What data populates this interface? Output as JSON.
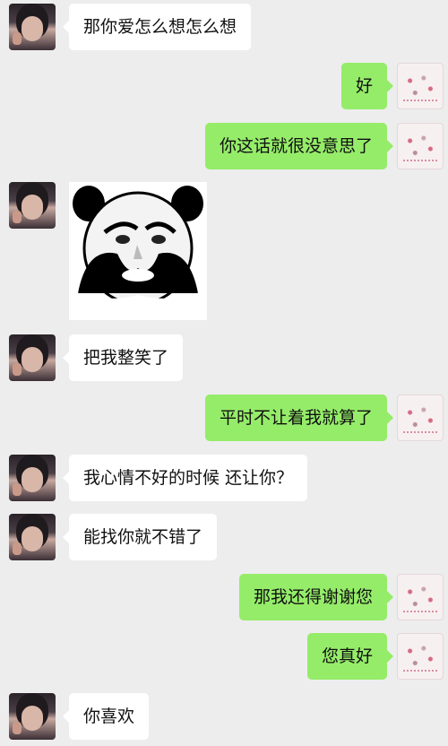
{
  "messages": [
    {
      "side": "in",
      "text": "那你爱怎么想怎么想"
    },
    {
      "side": "out",
      "text": "好"
    },
    {
      "side": "out",
      "text": "你这话就很没意思了"
    },
    {
      "side": "in",
      "type": "sticker",
      "sticker": "panda-meme-sticker"
    },
    {
      "side": "in",
      "text": "把我整笑了"
    },
    {
      "side": "out",
      "text": "平时不让着我就算了"
    },
    {
      "side": "in",
      "text": "我心情不好的时候 还让你？"
    },
    {
      "side": "in",
      "text": "能找你就不错了"
    },
    {
      "side": "out",
      "text": "那我还得谢谢您"
    },
    {
      "side": "out",
      "text": "您真好"
    },
    {
      "side": "in",
      "text": "你喜欢"
    }
  ],
  "colors": {
    "background": "#ededed",
    "incoming_bubble": "#ffffff",
    "outgoing_bubble": "#95ec69"
  }
}
